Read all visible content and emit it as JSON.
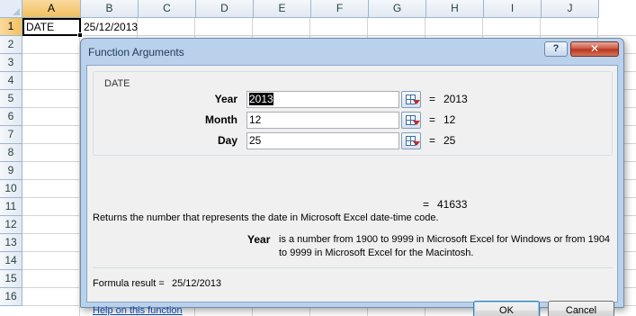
{
  "spreadsheet": {
    "columns": [
      "A",
      "B",
      "C",
      "D",
      "E",
      "F",
      "G",
      "H",
      "I",
      "J"
    ],
    "rows": [
      "1",
      "2",
      "3",
      "4",
      "5",
      "6",
      "7",
      "8",
      "9",
      "10",
      "11",
      "12",
      "13",
      "14",
      "15",
      "16"
    ],
    "cells": {
      "A1": "DATE",
      "B1": "25/12/2013"
    },
    "selected_cell": "A1"
  },
  "dialog": {
    "title": "Function Arguments",
    "help_button": "?",
    "close_button": "✕",
    "function_name": "DATE",
    "arguments": [
      {
        "label": "Year",
        "input": "2013",
        "value": "2013",
        "equals": "="
      },
      {
        "label": "Month",
        "input": "12",
        "value": "12",
        "equals": "="
      },
      {
        "label": "Day",
        "input": "25",
        "value": "25",
        "equals": "="
      }
    ],
    "result_equals": "=",
    "result": "41633",
    "description": "Returns the number that represents the date in Microsoft Excel date-time code.",
    "arg_help_name": "Year",
    "arg_help_text": "is a number from 1900 to 9999 in Microsoft Excel for Windows or from 1904 to 9999 in Microsoft Excel for the Macintosh.",
    "formula_result_label": "Formula result =",
    "formula_result_value": "25/12/2013",
    "help_link": "Help on this function",
    "ok_label": "OK",
    "cancel_label": "Cancel"
  }
}
